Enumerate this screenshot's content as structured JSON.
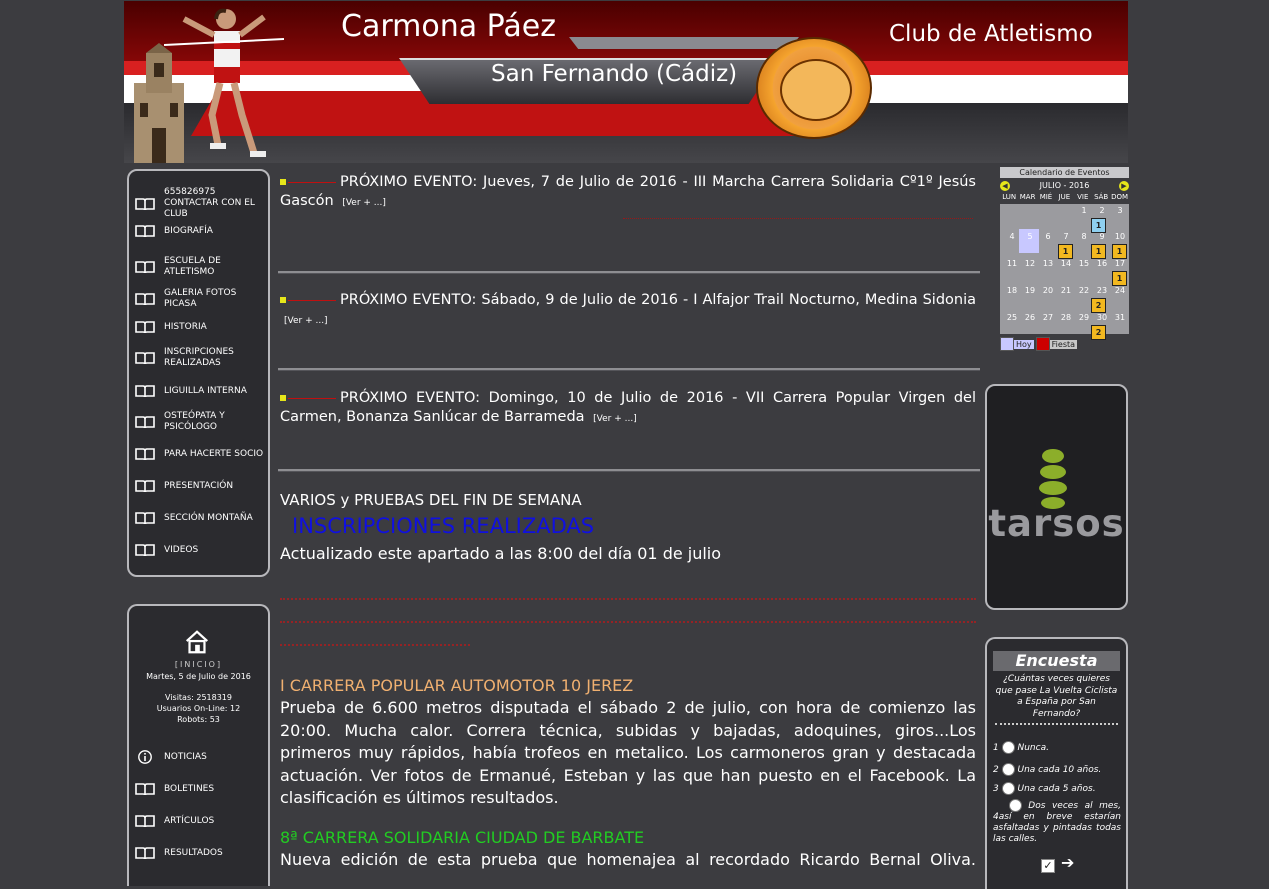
{
  "header": {
    "title": "Carmona Páez",
    "subtitle": "San Fernando (Cádiz)",
    "club": "Club de Atletismo"
  },
  "menu": {
    "items": [
      {
        "label": "655826975 CONTACTAR CON EL CLUB",
        "icon": "book-icon"
      },
      {
        "label": "BIOGRAFÍA",
        "icon": "book-icon"
      },
      {
        "label": "ESCUELA DE ATLETISMO",
        "icon": "book-icon"
      },
      {
        "label": "GALERIA FOTOS PICASA",
        "icon": "book-icon"
      },
      {
        "label": "HISTORIA",
        "icon": "book-icon"
      },
      {
        "label": "INSCRIPCIONES REALIZADAS",
        "icon": "book-icon"
      },
      {
        "label": "LIGUILLA INTERNA",
        "icon": "book-icon"
      },
      {
        "label": "OSTEÓPATA Y PSICÓLOGO",
        "icon": "book-icon"
      },
      {
        "label": "PARA HACERTE SOCIO",
        "icon": "book-icon"
      },
      {
        "label": "PRESENTACIÓN",
        "icon": "book-icon"
      },
      {
        "label": "SECCIÓN MONTAÑA",
        "icon": "book-icon"
      },
      {
        "label": "VIDEOS",
        "icon": "book-icon"
      }
    ]
  },
  "info": {
    "home_label": "[INICIO]",
    "date": "Martes, 5 de Julio de 2016",
    "visits": "Visitas: 2518319",
    "online": "Usuarios On-Line: 12",
    "robots": "Robots: 53",
    "items": [
      {
        "label": "NOTICIAS",
        "icon": "info-icon"
      },
      {
        "label": "BOLETINES",
        "icon": "book-icon"
      },
      {
        "label": "ARTÍCULOS",
        "icon": "book-icon"
      },
      {
        "label": "RESULTADOS",
        "icon": "book-icon"
      }
    ]
  },
  "events": [
    {
      "text": "PRÓXIMO EVENTO: Jueves, 7 de Julio de 2016 - III Marcha Carrera Solidaria Cº1º Jesús Gascón",
      "more": "[Ver + ...]"
    },
    {
      "text": "PRÓXIMO EVENTO: Sábado, 9 de Julio de 2016 - I Alfajor Trail Nocturno, Medina Sidonia",
      "more": "[Ver + ...]"
    },
    {
      "text": "PRÓXIMO EVENTO: Domingo, 10 de Julio de 2016 - VII Carrera Popular Virgen del Carmen, Bonanza Sanlúcar de Barrameda",
      "more": "[Ver + ...]"
    }
  ],
  "content": {
    "section_title": "VARIOS y PRUEBAS DEL FIN DE SEMANA",
    "inscripciones_link": "INSCRIPCIONES REALIZADAS",
    "updated": "Actualizado este apartado a las 8:00 del día 01 de julio",
    "race1_title": "I CARRERA POPULAR AUTOMOTOR 10 JEREZ",
    "race1_body": "Prueba de 6.600 metros disputada el sábado 2 de julio, con hora de comienzo las 20:00. Mucha calor. Correra técnica, subidas y bajadas, adoquines, giros...Los primeros muy rápidos, había trofeos en metalico. Los carmoneros gran y destacada actuación. Ver fotos de Ermanué, Esteban y las que han puesto en el Facebook. La clasificación es últimos resultados.",
    "race2_title": "8ª CARRERA SOLIDARIA CIUDAD DE BARBATE",
    "race2_body": "Nueva edición de esta prueba que homenajea al recordado Ricardo Bernal Oliva. Tarde"
  },
  "calendar": {
    "title": "Calendario de Eventos",
    "month": "JULIO - 2016",
    "weekdays": [
      "LUN",
      "MAR",
      "MIÉ",
      "JUE",
      "VIE",
      "SÁB",
      "DOM"
    ],
    "legend_today": "Hoy",
    "legend_holiday": "Fiesta",
    "colors": {
      "today": "#c8c8ff",
      "holiday": "#cc0000",
      "event": "#f2b820",
      "selected": "#8fd0f0"
    }
  },
  "poll": {
    "title": "Encuesta",
    "question": "¿Cuántas veces quieres que pase La Vuelta Ciclista a España por San Fernando?",
    "options": [
      {
        "num": "1",
        "label": "Nunca."
      },
      {
        "num": "2",
        "label": "Una cada 10 años."
      },
      {
        "num": "3",
        "label": "Una cada 5 años."
      },
      {
        "num": "4",
        "label": "Dos veces al mes, así en breve estarían asfaltadas y pintadas todas las calles."
      }
    ]
  },
  "sponsor": {
    "name": "tarsos"
  }
}
